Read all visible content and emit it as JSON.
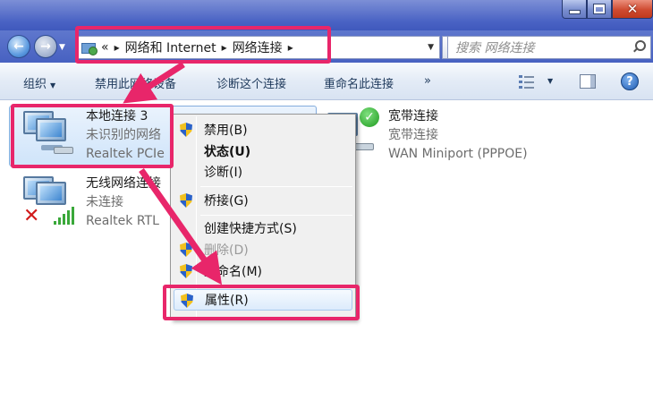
{
  "window": {
    "close_glyph": "✕"
  },
  "navbar": {
    "back_icon": "back-arrow-icon",
    "forward_icon": "forward-arrow-icon",
    "breadcrumb": {
      "prefix": "«",
      "item1": "网络和 Internet",
      "item2": "网络连接"
    },
    "search_placeholder": "搜索 网络连接"
  },
  "cmdbar": {
    "organize": "组织",
    "disable_device": "禁用此网络设备",
    "diagnose": "诊断这个连接",
    "rename": "重命名此连接",
    "more": "»",
    "help": "?"
  },
  "connections": [
    {
      "name": "本地连接 3",
      "status": "未识别的网络",
      "adapter": "Realtek PCIe"
    },
    {
      "name": "无线网络连接",
      "status": "未连接",
      "adapter": "Realtek RTL"
    },
    {
      "name": "宽带连接",
      "status": "宽带连接",
      "adapter": "WAN Miniport (PPPOE)"
    }
  ],
  "context_menu": {
    "disable": "禁用(B)",
    "status": "状态(U)",
    "diagnose": "诊断(I)",
    "bridge": "桥接(G)",
    "shortcut": "创建快捷方式(S)",
    "delete": "删除(D)",
    "rename": "重命名(M)",
    "properties": "属性(R)"
  },
  "colors": {
    "annotation": "#e8266a",
    "selection": "#cfe4fa",
    "aero_blue": "#4a63c4"
  }
}
